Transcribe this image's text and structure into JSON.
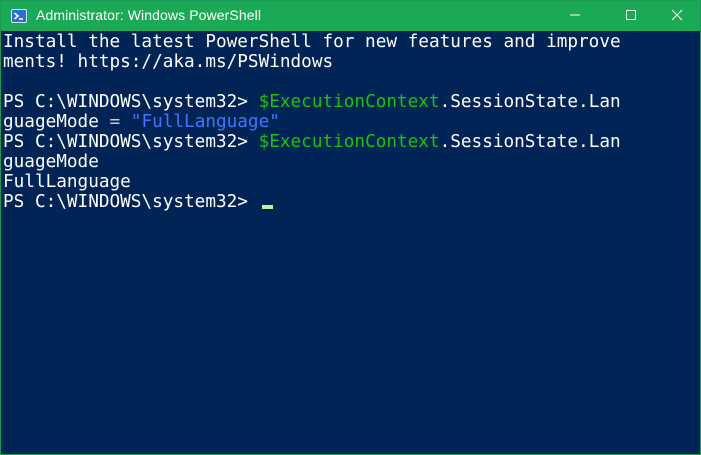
{
  "window": {
    "title": "Administrator: Windows PowerShell",
    "accent_color": "#1ca955",
    "console_bg": "#012456",
    "app_icon": "powershell-icon",
    "controls": {
      "minimize_icon": "minimize-icon",
      "maximize_icon": "maximize-icon",
      "close_icon": "close-icon"
    }
  },
  "console": {
    "banner_line1": "Install the latest PowerShell for new features and improve",
    "banner_line2": "ments! https://aka.ms/PSWindows",
    "cmd1": {
      "prompt": "PS C:\\WINDOWS\\system32> ",
      "variable": "$ExecutionContext",
      "member": ".SessionState.Lan",
      "wrap": "guageMode",
      "operator": " = ",
      "string": "\"FullLanguage\""
    },
    "cmd2": {
      "prompt": "PS C:\\WINDOWS\\system32> ",
      "variable": "$ExecutionContext",
      "member": ".SessionState.Lan",
      "wrap": "guageMode"
    },
    "output": "FullLanguage",
    "current_prompt": "PS C:\\WINDOWS\\system32> "
  }
}
